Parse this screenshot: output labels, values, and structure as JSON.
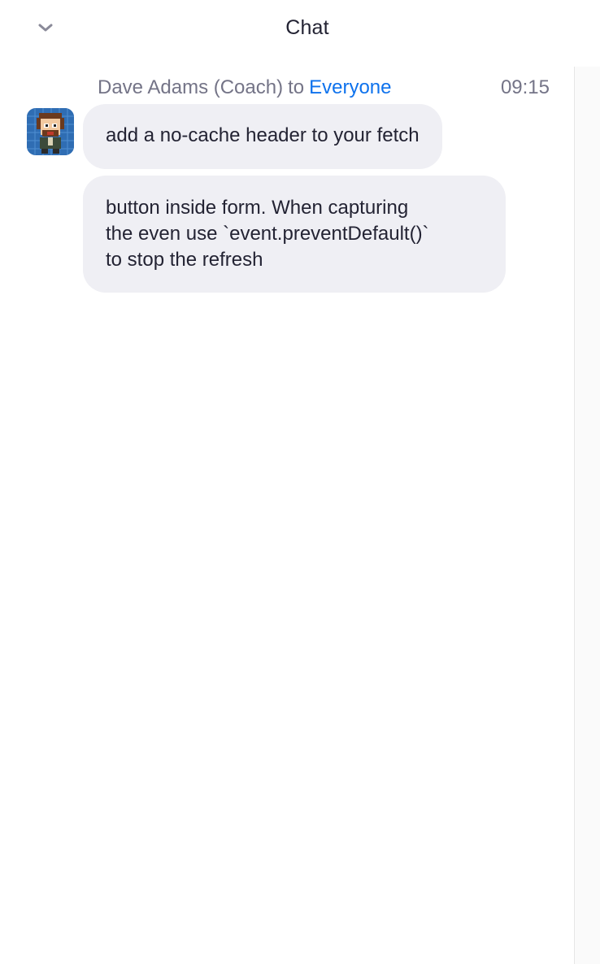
{
  "header": {
    "title": "Chat",
    "collapse_icon": "chevron-down-icon"
  },
  "messages": [
    {
      "sender": "Dave Adams (Coach)",
      "to_word": "to",
      "recipient": "Everyone",
      "time": "09:15",
      "avatar": "pixel-art-avatar",
      "bubbles": [
        "add a no-cache header to your fetch",
        "button inside form. When capturing\nthe even use `event.preventDefault()`\nto stop the refresh"
      ]
    }
  ],
  "colors": {
    "text": "#232333",
    "meta": "#747487",
    "link": "#0e72ed",
    "bubble": "#efeff4"
  }
}
